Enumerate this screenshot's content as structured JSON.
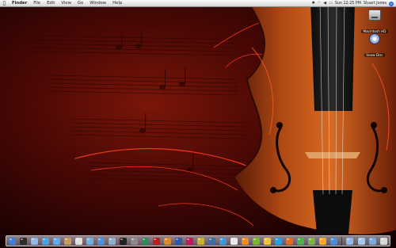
{
  "menubar": {
    "apple_icon": "apple-icon",
    "items": [
      "Finder",
      "File",
      "Edit",
      "View",
      "Go",
      "Window",
      "Help"
    ],
    "status_icons": [
      "bluetooth-icon",
      "wifi-icon",
      "volume-icon",
      "battery-icon"
    ],
    "clock": "Sun 12:25 PM",
    "user": "Stuart Jones",
    "spotlight_icon": "spotlight-icon"
  },
  "desktop": {
    "icons": [
      {
        "label": "Macintosh HD",
        "icon": "hard-drive-icon"
      },
      {
        "label": "Snow Disc",
        "icon": "disc-icon"
      }
    ]
  },
  "dock": {
    "apps": [
      {
        "name": "finder-icon",
        "color": "#3d7fd9"
      },
      {
        "name": "dashboard-icon",
        "color": "#2b2b2b"
      },
      {
        "name": "mail-icon",
        "color": "#8fb8e8"
      },
      {
        "name": "safari-icon",
        "color": "#4aa3e0"
      },
      {
        "name": "ichat-icon",
        "color": "#5fa8f0"
      },
      {
        "name": "address-book-icon",
        "color": "#c79a5a"
      },
      {
        "name": "ical-icon",
        "color": "#e0e0e0"
      },
      {
        "name": "iphoto-icon",
        "color": "#6bb0e0"
      },
      {
        "name": "itunes-icon",
        "color": "#4f8fe0"
      },
      {
        "name": "preview-icon",
        "color": "#8ab0d0"
      },
      {
        "name": "terminal-icon",
        "color": "#222222"
      },
      {
        "name": "system-preferences-icon",
        "color": "#8a8a8a"
      },
      {
        "name": "dreamweaver-icon",
        "color": "#2e8b57"
      },
      {
        "name": "flash-icon",
        "color": "#b52020"
      },
      {
        "name": "illustrator-icon",
        "color": "#e08a1f"
      },
      {
        "name": "photoshop-icon",
        "color": "#2a5aa8"
      },
      {
        "name": "indesign-icon",
        "color": "#c2185b"
      },
      {
        "name": "fireworks-icon",
        "color": "#c9b227"
      },
      {
        "name": "lightroom-icon",
        "color": "#3a6ea5"
      },
      {
        "name": "quicktime-icon",
        "color": "#3c9ad8"
      },
      {
        "name": "textedit-icon",
        "color": "#e8e8e8"
      },
      {
        "name": "vlc-icon",
        "color": "#f28c1e"
      },
      {
        "name": "utorrent-icon",
        "color": "#77b72b"
      },
      {
        "name": "adium-icon",
        "color": "#f1c232"
      },
      {
        "name": "skype-icon",
        "color": "#1fa0e0"
      },
      {
        "name": "firefox-icon",
        "color": "#e66a1f"
      },
      {
        "name": "chrome-icon",
        "color": "#4caf50"
      },
      {
        "name": "coda-icon",
        "color": "#7cb342"
      },
      {
        "name": "transmit-icon",
        "color": "#f9a825"
      },
      {
        "name": "xcode-icon",
        "color": "#4a90d9"
      }
    ],
    "docs": [
      {
        "name": "applications-stack-icon",
        "color": "#8fb8e8"
      },
      {
        "name": "documents-stack-icon",
        "color": "#a7c6ea"
      },
      {
        "name": "downloads-stack-icon",
        "color": "#7ea8dc"
      },
      {
        "name": "trash-icon",
        "color": "#d8d8d8"
      }
    ]
  }
}
